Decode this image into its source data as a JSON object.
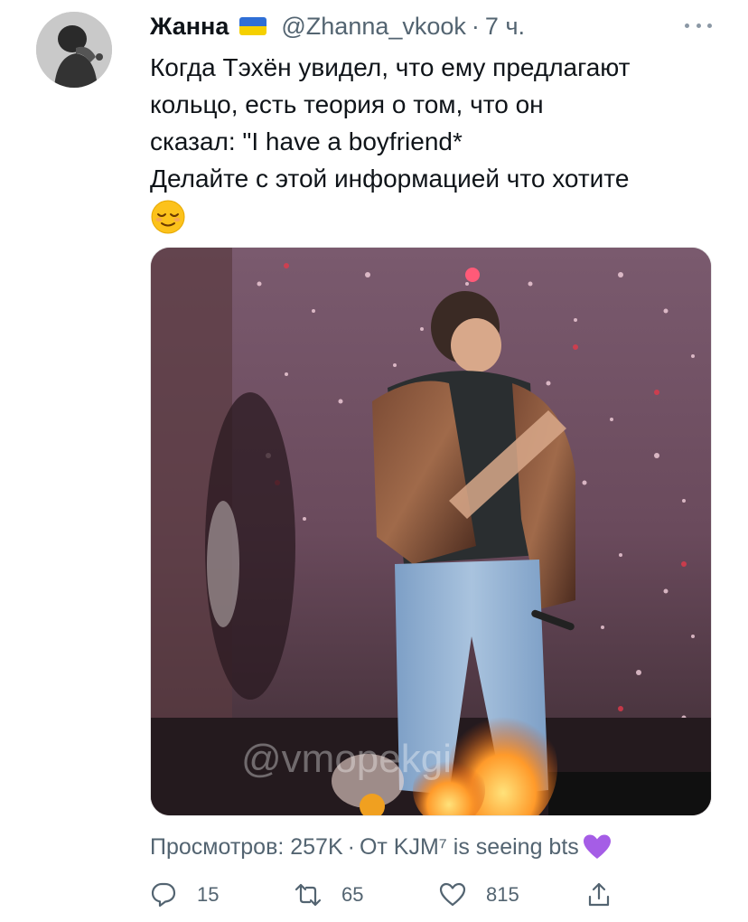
{
  "author": {
    "name": "Жанна",
    "flag_icon": "ukraine-flag-icon",
    "handle": "@Zhanna_vkook",
    "separator": "·",
    "time": "7 ч."
  },
  "tweet": {
    "lines": [
      "Когда Тэхён увидел, что ему предлагают",
      "кольцо, есть теория о том, что он",
      "сказал: \"I have a boyfriend*",
      "Делайте с этой информацией что хотите"
    ],
    "emoji": "relieved-face-emoji"
  },
  "media": {
    "watermark": "@vmopekgi",
    "kind": "video-still"
  },
  "meta": {
    "views_label": "Просмотров: 257K",
    "separator": "·",
    "from_label": "От KJM⁷ is seeing bts",
    "emoji": "purple-heart-emoji"
  },
  "actions": {
    "reply_count": "15",
    "retweet_count": "65",
    "like_count": "815"
  },
  "colors": {
    "text_primary": "#0f1419",
    "text_secondary": "#536471",
    "purple_heart": "#a55de6"
  }
}
